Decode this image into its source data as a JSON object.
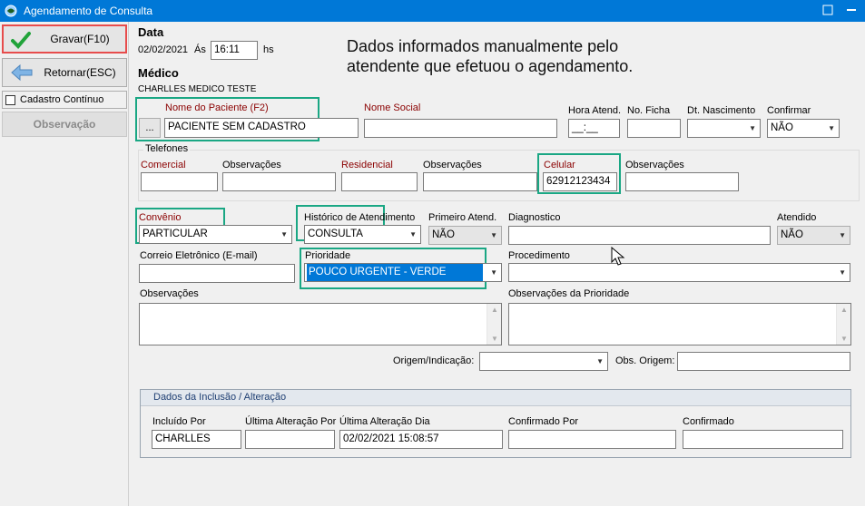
{
  "window": {
    "title": "Agendamento de Consulta"
  },
  "left_panel": {
    "save_label": "Gravar(F10)",
    "back_label": "Retornar(ESC)",
    "continuous_label": "Cadastro Contínuo",
    "observation_label": "Observação"
  },
  "header": {
    "data_label": "Data",
    "date_value": "02/02/2021",
    "as_label": "Ás",
    "time_value": "16:11",
    "hs_label": "hs",
    "medico_label": "Médico",
    "medico_value": "CHARLLES MEDICO TESTE"
  },
  "annotation": "Dados informados manualmente pelo atendente que efetuou o agendamento.",
  "patient": {
    "name_label": "Nome do Paciente (F2)",
    "lookup_label": "...",
    "name_value": "PACIENTE SEM CADASTRO",
    "social_label": "Nome Social",
    "social_value": "",
    "hora_label": "Hora Atend.",
    "hora_value": "__:__",
    "ficha_label": "No. Ficha",
    "ficha_value": "",
    "nasc_label": "Dt. Nascimento",
    "nasc_value": "",
    "confirmar_label": "Confirmar",
    "confirmar_value": "NÃO"
  },
  "phones": {
    "group_label": "Telefones",
    "comercial_label": "Comercial",
    "comercial_value": "",
    "obs1_label": "Observações",
    "obs1_value": "",
    "residencial_label": "Residencial",
    "residencial_value": "",
    "obs2_label": "Observações",
    "obs2_value": "",
    "celular_label": "Celular",
    "celular_value": "62912123434",
    "obs3_label": "Observações",
    "obs3_value": ""
  },
  "details": {
    "convenio_label": "Convênio",
    "convenio_value": "PARTICULAR",
    "historico_label": "Histórico de Atendimento",
    "historico_value": "CONSULTA",
    "primeiro_label": "Primeiro Atend.",
    "primeiro_value": "NÃO",
    "diagnostico_label": "Diagnostico",
    "diagnostico_value": "",
    "atendido_label": "Atendido",
    "atendido_value": "NÃO",
    "email_label": "Correio Eletrônico (E-mail)",
    "email_value": "",
    "prioridade_label": "Prioridade",
    "prioridade_value": "POUCO URGENTE - VERDE",
    "procedimento_label": "Procedimento",
    "procedimento_value": "",
    "obs_label": "Observações",
    "obs_prioridade_label": "Observações da Prioridade",
    "origem_label": "Origem/Indicação:",
    "origem_value": "",
    "obs_origem_label": "Obs. Origem:",
    "obs_origem_value": ""
  },
  "inclusao": {
    "group_label": "Dados da Inclusão / Alteração",
    "incluido_label": "Incluído Por",
    "incluido_value": "CHARLLES",
    "ult_por_label": "Última Alteração Por",
    "ult_por_value": "",
    "ult_dia_label": "Última Alteração Dia",
    "ult_dia_value": "02/02/2021 15:08:57",
    "conf_por_label": "Confirmado Por",
    "conf_por_value": "",
    "confirmado_label": "Confirmado",
    "confirmado_value": ""
  },
  "colors": {
    "titlebar": "#0078d7",
    "highlight_green": "#1aa784",
    "highlight_red": "#e74c4c",
    "label_red": "#8b0000",
    "selection_blue": "#0078d7"
  },
  "icons": [
    "app-icon",
    "check-icon",
    "arrow-left-icon",
    "minimize-icon",
    "close-icon",
    "mouse-cursor-icon"
  ]
}
